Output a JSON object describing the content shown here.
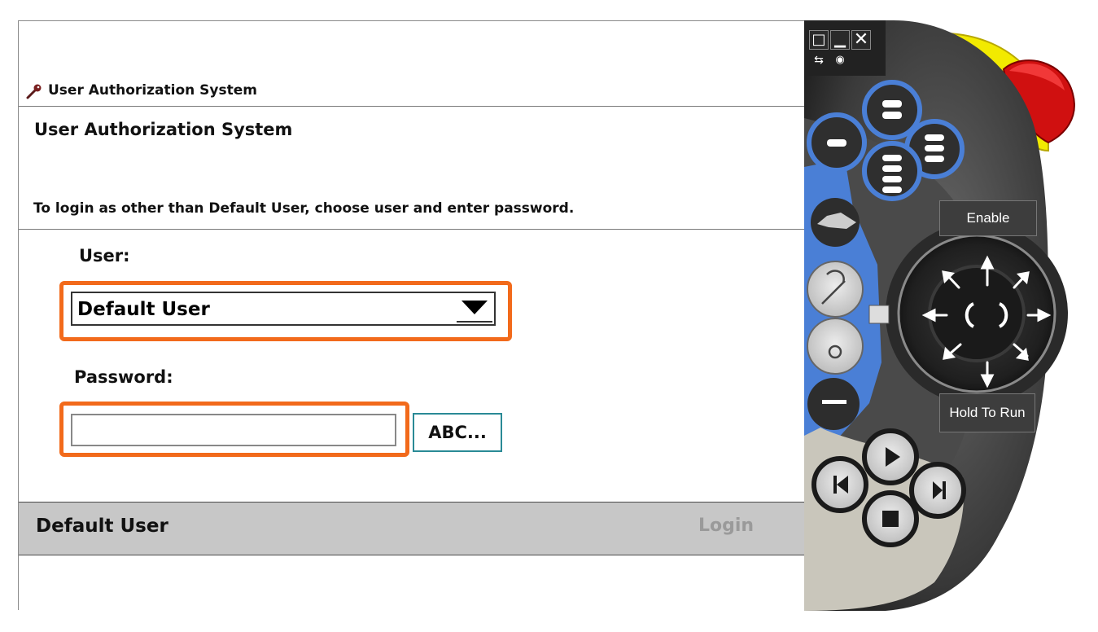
{
  "window": {
    "title": "User Authorization System",
    "heading": "User Authorization System",
    "instruction": "To login as other than Default User, choose user and enter password."
  },
  "form": {
    "user_label": "User:",
    "user_selected": "Default User",
    "password_label": "Password:",
    "password_value": "",
    "keyboard_button": "ABC..."
  },
  "status_bar": {
    "current_user": "Default User",
    "login_button": "Login"
  },
  "pendant": {
    "enable_label": "Enable",
    "hold_to_run_label": "Hold To Run",
    "window_controls": [
      "maximize-icon",
      "minimize-icon",
      "close-icon",
      "swap-icon",
      "camera-icon"
    ]
  },
  "colors": {
    "highlight": "#f26a1b",
    "pendant_blue": "#4a7fd6",
    "pendant_yellow": "#f4f000",
    "pendant_red": "#e01010",
    "status_bar": "#c7c7c7"
  }
}
